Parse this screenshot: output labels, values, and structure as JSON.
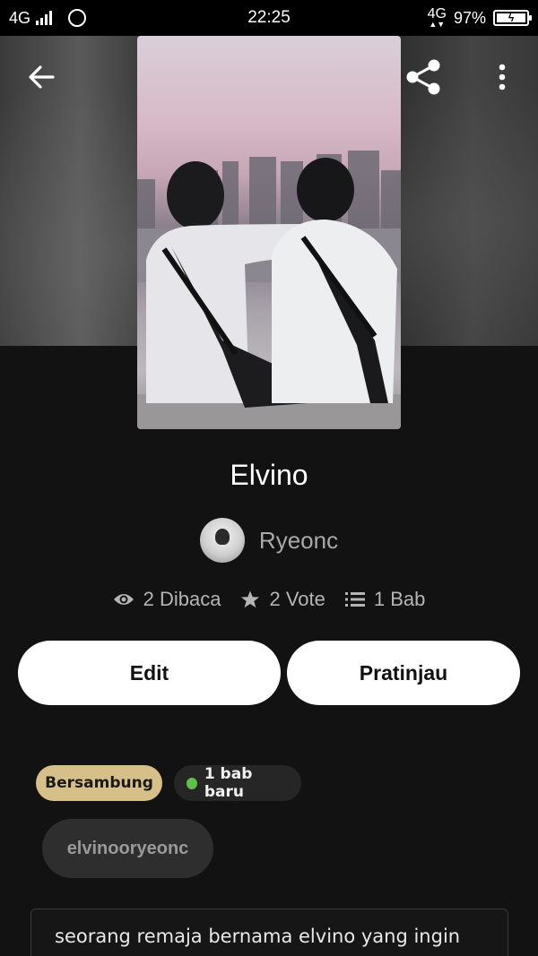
{
  "status_bar": {
    "network_left": "4G",
    "time": "22:25",
    "network_right": "4G",
    "battery": "97%"
  },
  "header": {
    "back_icon": "arrow-left-icon",
    "share_icon": "share-icon",
    "more_icon": "more-vertical-icon"
  },
  "story": {
    "title": "Elvino",
    "author": "Ryeonc",
    "stats": {
      "reads": "2 Dibaca",
      "votes": "2 Vote",
      "parts": "1 Bab"
    }
  },
  "actions": {
    "edit_label": "Edit",
    "preview_label": "Pratinjau"
  },
  "badges": {
    "status": "Bersambung",
    "new_chapters": "1 bab baru",
    "new_dot_color": "#5fbf4b"
  },
  "tags": [
    "elvinooryeonc"
  ],
  "description": "seorang remaja bernama elvino yang ingin",
  "colors": {
    "background": "#121212",
    "status_badge": "#d7bf8a",
    "button_bg": "#ffffff"
  }
}
